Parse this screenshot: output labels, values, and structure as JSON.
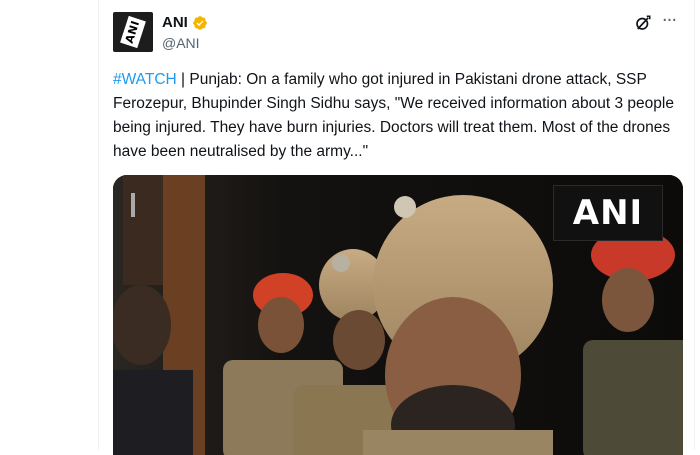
{
  "tweet": {
    "author": {
      "name": "ANI",
      "handle": "@ANI",
      "avatar_text": "ANI",
      "verified_color": "#f4b400"
    },
    "hashtag": "#WATCH",
    "body": " | Punjab: On a family who got injured in Pakistani drone attack, SSP Ferozepur, Bhupinder Singh Sidhu says, \"We received information about 3 people being injured. They have burn injuries. Doctors will treat them. Most of the drones have been neutralised by the army...\"",
    "media": {
      "watermark": "ANI"
    },
    "actions": {
      "grok_icon": "grok-icon",
      "more_icon": "more-icon",
      "more_glyph": "···"
    }
  },
  "colors": {
    "accent": "#1d9bf0",
    "text": "#0f1419",
    "muted": "#536471"
  }
}
